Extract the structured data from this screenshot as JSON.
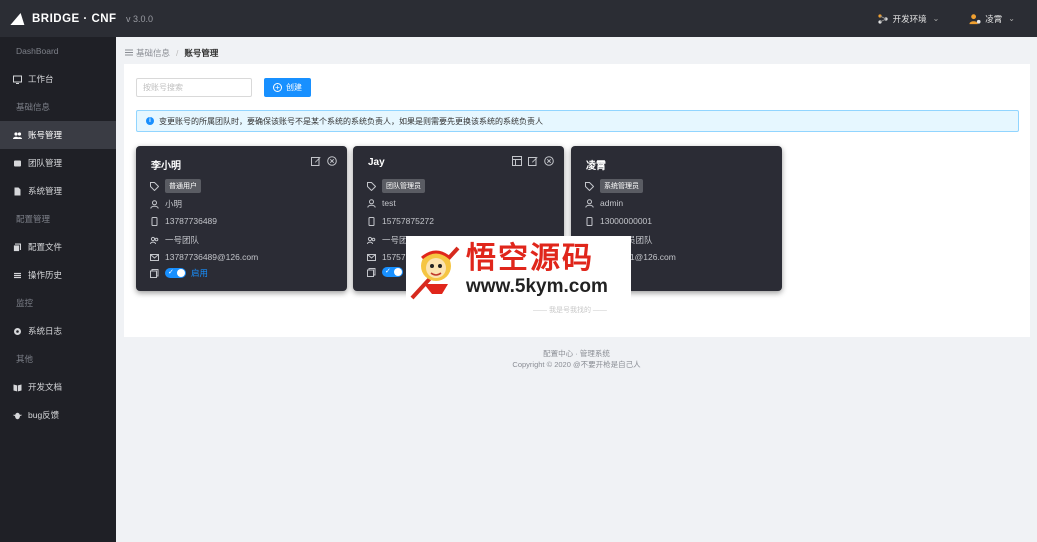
{
  "header": {
    "app_name": "BRIDGE · CNF",
    "version": "v 3.0.0",
    "env_label": "开发环境",
    "user_name": "凌霄"
  },
  "sidebar": {
    "groups": [
      {
        "label": "DashBoard",
        "items": [
          {
            "label": "工作台",
            "icon": "monitor-icon"
          }
        ]
      },
      {
        "label": "基础信息",
        "items": [
          {
            "label": "账号管理",
            "icon": "user-group-icon",
            "active": true
          },
          {
            "label": "团队管理",
            "icon": "team-icon"
          },
          {
            "label": "系统管理",
            "icon": "file-icon"
          }
        ]
      },
      {
        "label": "配置管理",
        "items": [
          {
            "label": "配置文件",
            "icon": "copy-icon"
          },
          {
            "label": "操作历史",
            "icon": "list-icon"
          }
        ]
      },
      {
        "label": "监控",
        "items": [
          {
            "label": "系统日志",
            "icon": "gear-icon"
          }
        ]
      },
      {
        "label": "其他",
        "items": [
          {
            "label": "开发文档",
            "icon": "book-icon"
          },
          {
            "label": "bug反馈",
            "icon": "bug-icon"
          }
        ]
      }
    ]
  },
  "breadcrumb": {
    "parent": "基础信息",
    "sep": "/",
    "current": "账号管理"
  },
  "toolbar": {
    "search_placeholder": "按账号搜索",
    "create_label": "创建"
  },
  "alert": {
    "text": "变更账号的所属团队时，要确保该账号不是某个系统的系统负责人，如果是则需要先更换该系统的系统负责人"
  },
  "cards": [
    {
      "name": "李小明",
      "role": "普通用户",
      "username": "小明",
      "phone": "13787736489",
      "team": "一号团队",
      "email": "13787736489@126.com",
      "status_label": "启用",
      "enabled": true,
      "actions": [
        "edit-icon",
        "close-circle-icon"
      ]
    },
    {
      "name": "Jay",
      "role": "团队管理员",
      "username": "test",
      "phone": "15757875272",
      "team": "一号团",
      "email": "15757",
      "status_label": "",
      "enabled": true,
      "actions": [
        "layout-icon",
        "edit-icon",
        "close-circle-icon"
      ]
    },
    {
      "name": "凌霄",
      "role": "系统管理员",
      "username": "admin",
      "phone": "13000000001",
      "team": "员团队",
      "email": "00001@126.com",
      "status_label": "用",
      "enabled": true,
      "actions": []
    }
  ],
  "watermark": {
    "title": "悟空源码",
    "url": "www.5kym.com",
    "sub": "—— 我是号我找的 ——"
  },
  "footer": {
    "line1": "配置中心 · 管理系统",
    "line2": "Copyright © 2020 @不要开枪是自己人"
  },
  "colors": {
    "header_bg": "#2b2d34",
    "sidebar_bg": "#1f2026",
    "card_bg": "#2b2c35",
    "accent": "#1890ff",
    "watermark_red": "#e0261b"
  }
}
